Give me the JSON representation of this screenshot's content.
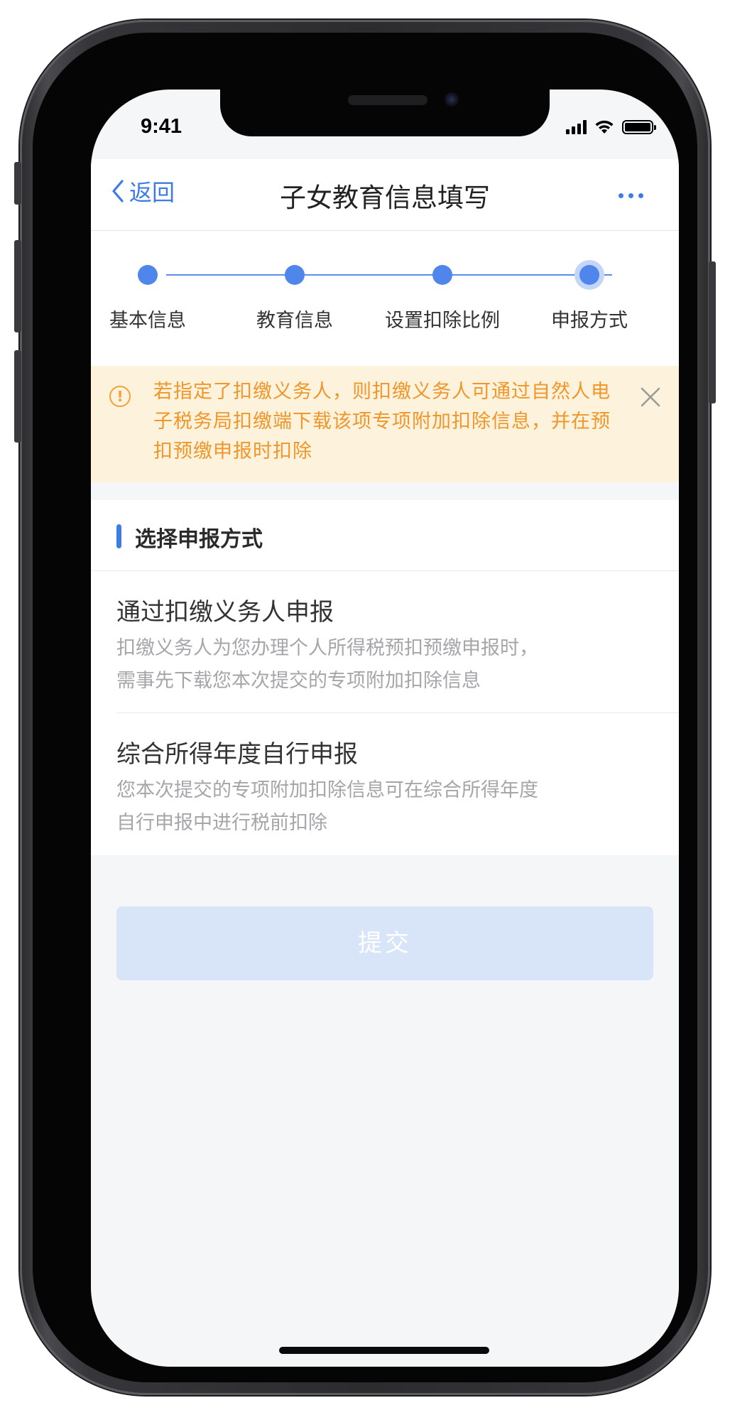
{
  "status_bar": {
    "time": "9:41"
  },
  "navbar": {
    "back_label": "返回",
    "title": "子女教育信息填写"
  },
  "steps": [
    {
      "label": "基本信息"
    },
    {
      "label": "教育信息"
    },
    {
      "label": "设置扣除比例"
    },
    {
      "label": "申报方式"
    }
  ],
  "notice": {
    "text": "若指定了扣缴义务人，则扣缴义务人可通过自然人电子税务局扣缴端下载该项专项附加扣除信息，并在预扣预缴申报时扣除",
    "color": "#f0962a",
    "background": "#fdf2dc"
  },
  "section": {
    "title": "选择申报方式",
    "options": [
      {
        "title": "通过扣缴义务人申报",
        "desc_line1": "扣缴义务人为您办理个人所得税预扣预缴申报时，",
        "desc_line2": "需事先下载您本次提交的专项附加扣除信息"
      },
      {
        "title": "综合所得年度自行申报",
        "desc_line1": "您本次提交的专项附加扣除信息可在综合所得年度",
        "desc_line2": "自行申报中进行税前扣除"
      }
    ]
  },
  "submit": {
    "label": "提交"
  },
  "colors": {
    "accent": "#3d7be6",
    "submit_disabled": "#d8e5f9"
  }
}
